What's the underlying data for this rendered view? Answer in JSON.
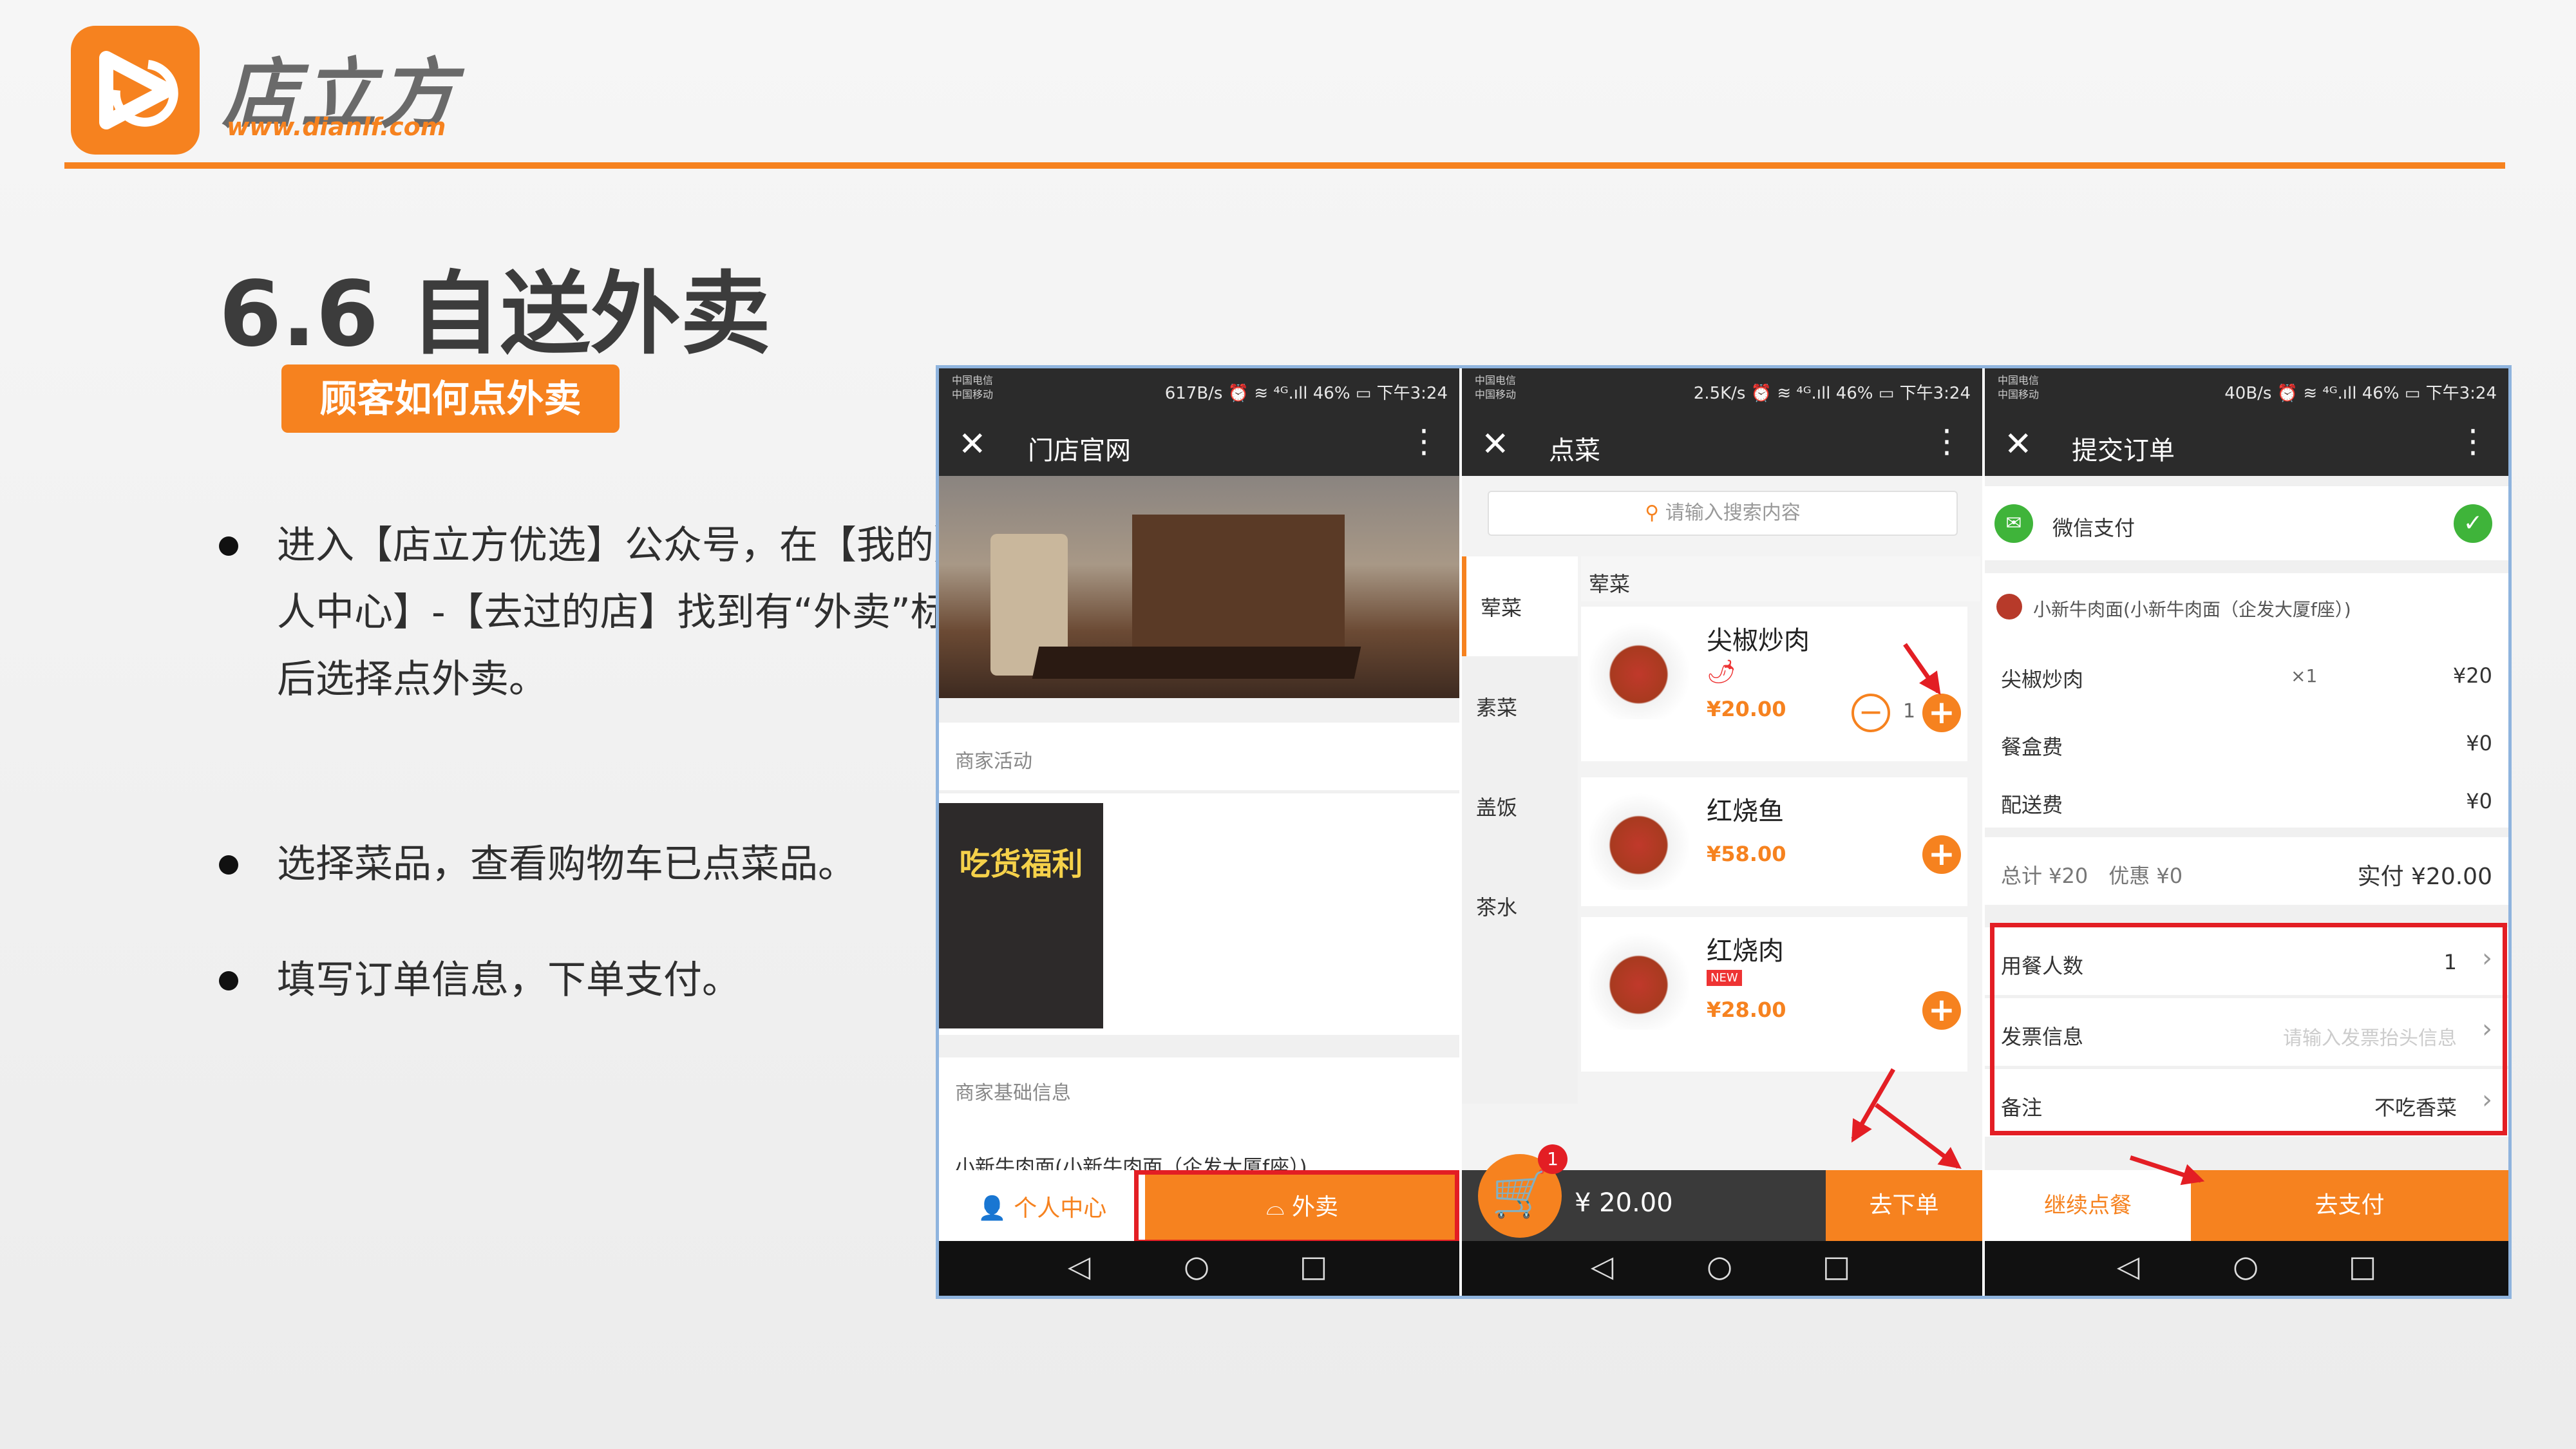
{
  "header": {
    "brand_name": "店立方",
    "brand_url": "www.dianlf.com",
    "accent_color": "#f6821f"
  },
  "slide": {
    "title": "6.6 自送外卖",
    "badge": "顾客如何点外卖",
    "bullets": [
      "进入【店立方优选】公众号，在【我的】-【个人中心】-【去过的店】找到有“外卖”标志的店后选择点外卖。",
      "选择菜品，查看购物车已点菜品。",
      "填写订单信息，下单支付。"
    ]
  },
  "phone1": {
    "status_left": "中国电信\n中国移动",
    "status_right": "617B/s ⏰ ≋ ⁴ᴳ.ıll 46% ▭ 下午3:24",
    "nav_title": "门店官网",
    "section_activity": "商家活动",
    "poster_text": "吃货福利",
    "section_info": "商家基础信息",
    "shop_name": "小新牛肉面(小新牛肉面（企发大厦f座）)",
    "btn_personal": "个人中心",
    "btn_takeout": "外卖"
  },
  "phone2": {
    "status_left": "中国电信\n中国移动",
    "status_right": "2.5K/s ⏰ ≋ ⁴ᴳ.ıll 46% ▭ 下午3:24",
    "nav_title": "点菜",
    "search_placeholder": "请输入搜索内容",
    "categories": [
      "荤菜",
      "素菜",
      "盖饭",
      "茶水"
    ],
    "group_header": "荤菜",
    "dishes": [
      {
        "name": "尖椒炒肉",
        "price": "¥20.00",
        "qty": "1"
      },
      {
        "name": "红烧鱼",
        "price": "¥58.00"
      },
      {
        "name": "红烧肉",
        "price": "¥28.00"
      }
    ],
    "cart_count": "1",
    "cart_total": "¥ 20.00",
    "btn_order": "去下单"
  },
  "phone3": {
    "status_left": "中国电信\n中国移动",
    "status_right": "40B/s ⏰ ≋ ⁴ᴳ.ıll 46% ▭ 下午3:24",
    "nav_title": "提交订单",
    "pay_method": "微信支付",
    "shop_name": "小新牛肉面(小新牛肉面（企发大厦f座）)",
    "item_name": "尖椒炒肉",
    "item_qty": "×1",
    "item_price": "¥20",
    "box_fee_label": "餐盒费",
    "box_fee": "¥0",
    "delivery_label": "配送费",
    "delivery_fee": "¥0",
    "summary_left": "总计 ¥20　优惠 ¥0",
    "summary_right": "实付 ¥20.00",
    "diners_label": "用餐人数",
    "diners_value": "1",
    "invoice_label": "发票信息",
    "invoice_placeholder": "请输入发票抬头信息",
    "note_label": "备注",
    "note_value": "不吃香菜",
    "btn_continue": "继续点餐",
    "btn_pay": "去支付"
  }
}
